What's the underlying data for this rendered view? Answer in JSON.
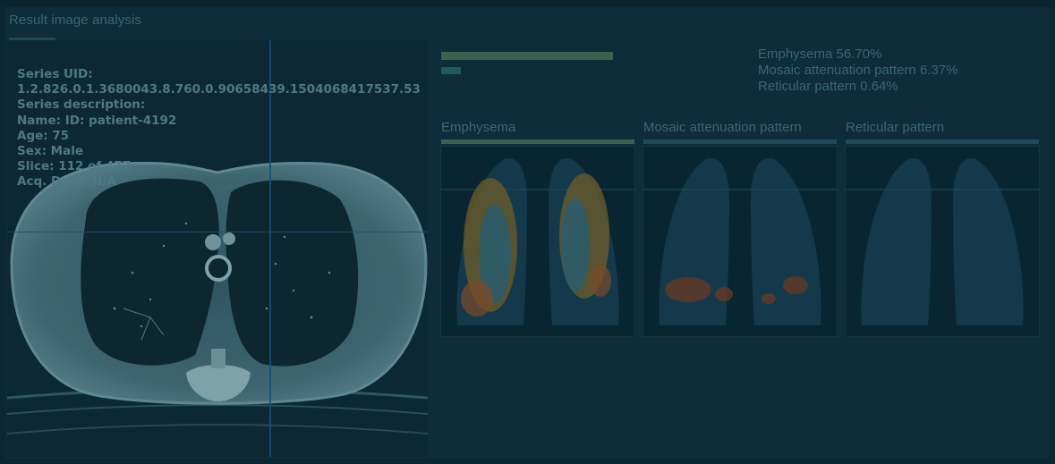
{
  "header": {
    "title": "Result image analysis"
  },
  "viewer": {
    "series_uid_label": "Series UID:",
    "series_uid_value": "1.2.826.0.1.3680043.8.760.0.90658439.1504068417537.53",
    "series_description_label": "Series description:",
    "name": "Name: ID: patient-4192",
    "age": "Age: 75",
    "sex": "Sex: Male",
    "slice": "Slice: 112 of 477",
    "acq_date": "Acq. Date: N/A"
  },
  "results": {
    "bars": [
      {
        "label": "Emphysema",
        "fraction": 0.567,
        "color": "#3d6150"
      },
      {
        "label": "Mosaic attenuation pattern",
        "fraction": 0.0637,
        "color": "#1f5a5e"
      },
      {
        "label": "Reticular pattern",
        "fraction": 0.0064,
        "color": "#1f5a5e"
      }
    ],
    "legend": [
      "Emphysema 56.70%",
      "Mosaic attenuation pattern 6.37%",
      "Reticular pattern 0.64%"
    ],
    "maps": [
      {
        "title": "Emphysema",
        "accent": "#3d6150",
        "heat": "high"
      },
      {
        "title": "Mosaic attenuation pattern",
        "accent": "#1f4a59",
        "heat": "low"
      },
      {
        "title": "Reticular pattern",
        "accent": "#1f4a59",
        "heat": "none"
      }
    ]
  }
}
